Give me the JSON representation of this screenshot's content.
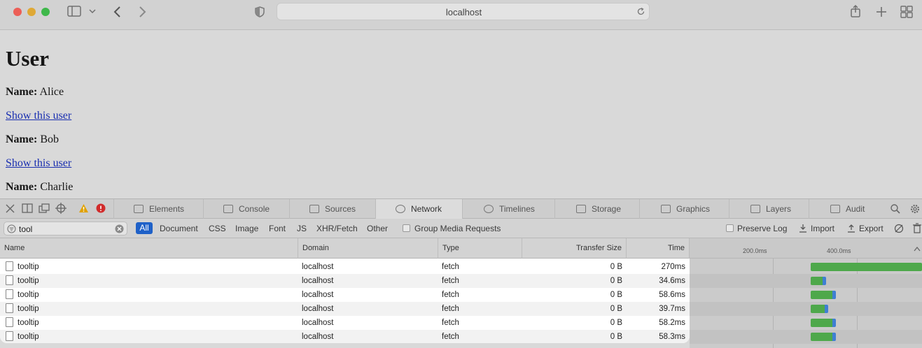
{
  "browser": {
    "url": "localhost"
  },
  "page": {
    "heading": "User",
    "users": [
      {
        "name_label": "Name:",
        "name": "Alice",
        "link": "Show this user"
      },
      {
        "name_label": "Name:",
        "name": "Bob",
        "link": "Show this user"
      },
      {
        "name_label": "Name:",
        "name": "Charlie"
      }
    ]
  },
  "devtools": {
    "tabs": [
      "Elements",
      "Console",
      "Sources",
      "Network",
      "Timelines",
      "Storage",
      "Graphics",
      "Layers",
      "Audit"
    ],
    "active_tab": "Network",
    "filter_value": "tool",
    "type_filters": [
      "All",
      "Document",
      "CSS",
      "Image",
      "Font",
      "JS",
      "XHR/Fetch",
      "Other"
    ],
    "group_media": "Group Media Requests",
    "preserve_log": "Preserve Log",
    "import_label": "Import",
    "export_label": "Export",
    "columns": {
      "name": "Name",
      "domain": "Domain",
      "type": "Type",
      "transfer_size": "Transfer Size",
      "time": "Time"
    },
    "timeline_ticks": [
      "200.0ms",
      "400.0ms"
    ],
    "requests": [
      {
        "name": "tooltip",
        "domain": "localhost",
        "type": "fetch",
        "size": "0 B",
        "time": "270ms",
        "time_ms": 270
      },
      {
        "name": "tooltip",
        "domain": "localhost",
        "type": "fetch",
        "size": "0 B",
        "time": "34.6ms",
        "time_ms": 34.6
      },
      {
        "name": "tooltip",
        "domain": "localhost",
        "type": "fetch",
        "size": "0 B",
        "time": "58.6ms",
        "time_ms": 58.6
      },
      {
        "name": "tooltip",
        "domain": "localhost",
        "type": "fetch",
        "size": "0 B",
        "time": "39.7ms",
        "time_ms": 39.7
      },
      {
        "name": "tooltip",
        "domain": "localhost",
        "type": "fetch",
        "size": "0 B",
        "time": "58.2ms",
        "time_ms": 58.2
      },
      {
        "name": "tooltip",
        "domain": "localhost",
        "type": "fetch",
        "size": "0 B",
        "time": "58.3ms",
        "time_ms": 58.3
      }
    ],
    "colors": {
      "accent": "#1f61c8",
      "bar_green": "#4ea84b",
      "bar_blue": "#3f7fd3",
      "warning": "#e0a100",
      "error": "#d12b2b"
    }
  }
}
